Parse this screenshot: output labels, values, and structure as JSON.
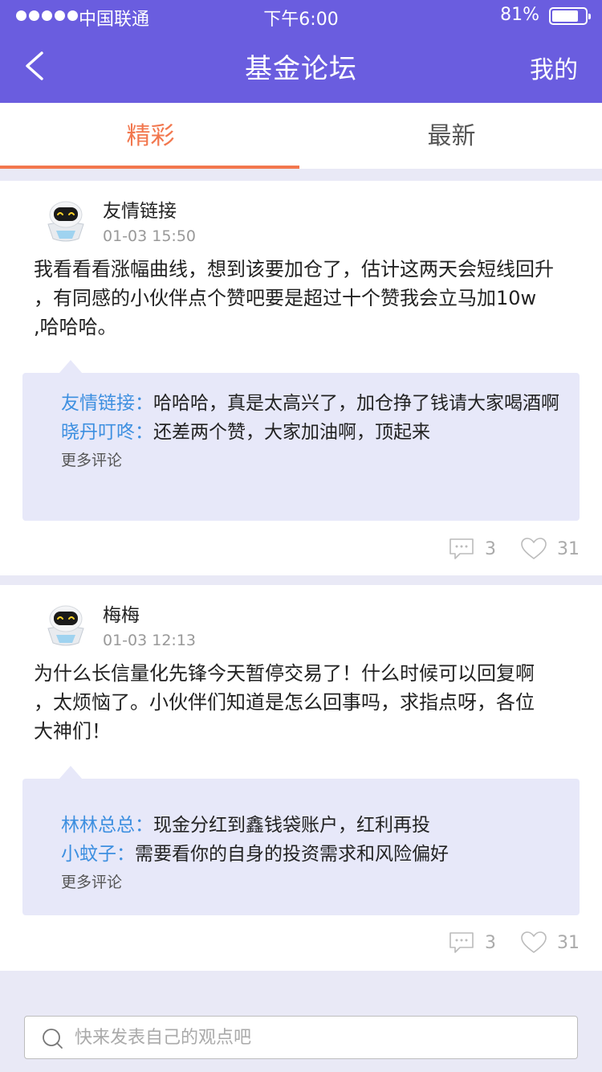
{
  "status_bar": {
    "carrier": "中国联通",
    "time": "下午6:00",
    "battery_percent": "81%",
    "battery_level": 0.81
  },
  "nav": {
    "title": "基金论坛",
    "right_label": "我的"
  },
  "tabs": [
    {
      "label": "精彩",
      "active": true
    },
    {
      "label": "最新",
      "active": false
    }
  ],
  "posts": [
    {
      "username": "友情链接",
      "timestamp": "01-03 15:50",
      "body_lines": [
        "我看看看涨幅曲线，想到该要加仓了，估计这两天会短线回升",
        "，有同感的小伙伴点个赞吧要是超过十个赞我会立马加10w",
        ",哈哈哈。"
      ],
      "comments": [
        {
          "user": "友情链接：",
          "text": "哈哈哈，真是太高兴了，加仓挣了钱请大家喝酒啊"
        },
        {
          "user": "晓丹叮咚：",
          "text": "还差两个赞，大家加油啊，顶起来"
        }
      ],
      "more_comments": "更多评论",
      "comment_count": "3",
      "like_count": "31"
    },
    {
      "username": "梅梅",
      "timestamp": "01-03 12:13",
      "body_lines": [
        "为什么长信量化先锋今天暂停交易了！什么时候可以回复啊",
        "，太烦恼了。小伙伴们知道是怎么回事吗，求指点呀，各位",
        "大神们！"
      ],
      "comments": [
        {
          "user": "林林总总：",
          "text": "现金分红到鑫钱袋账户，红利再投"
        },
        {
          "user": "小蚊子：",
          "text": "需要看你的自身的投资需求和风险偏好"
        }
      ],
      "more_comments": "更多评论",
      "comment_count": "3",
      "like_count": "31"
    }
  ],
  "input": {
    "placeholder": "快来发表自己的观点吧"
  },
  "icons": {
    "back": "chevron-left-icon",
    "avatar": "robot-avatar-icon",
    "comment": "speech-bubble-icon",
    "like": "heart-icon",
    "search": "search-icon"
  },
  "colors": {
    "header_bg": "#6a5ddf",
    "accent_tab": "#f2774e",
    "comment_user": "#3d8fe0",
    "comment_box_bg": "#e7e8f9",
    "page_bg": "#e9e9f6"
  }
}
